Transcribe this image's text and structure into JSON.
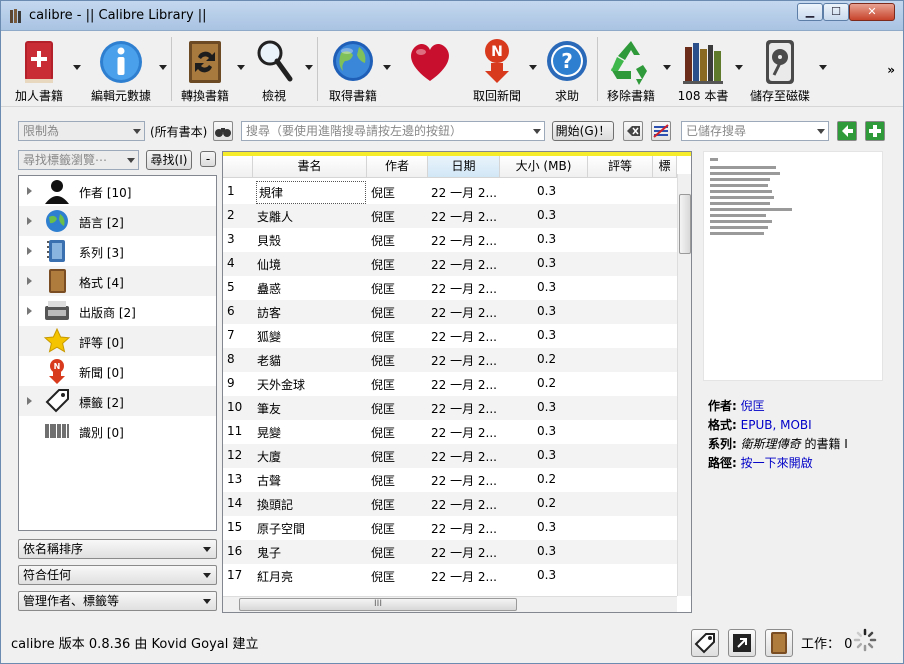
{
  "window": {
    "title": "calibre - || Calibre Library ||",
    "min": "▁",
    "max": "☐",
    "close": "✕"
  },
  "toolbar": {
    "buttons": [
      {
        "label": "加人書籍",
        "icon": "add-book-icon"
      },
      {
        "label": "編輯元數據",
        "icon": "info-icon"
      },
      {
        "label": "轉換書籍",
        "icon": "convert-book-icon"
      },
      {
        "label": "檢視",
        "icon": "magnifier-icon"
      },
      {
        "label": "取得書籍",
        "icon": "globe-icon"
      },
      {
        "label": "",
        "icon": "heart-icon"
      },
      {
        "label": "取回新聞",
        "icon": "news-icon"
      },
      {
        "label": "求助",
        "icon": "help-icon"
      },
      {
        "label": "移除書籍",
        "icon": "recycle-icon"
      },
      {
        "label": "108 本書",
        "icon": "library-icon"
      },
      {
        "label": "儲存至磁碟",
        "icon": "save-disk-icon"
      }
    ],
    "more": "»"
  },
  "search": {
    "restrict_placeholder": "限制為",
    "all_books": "(所有書本)",
    "search_placeholder": "搜尋（要使用進階搜尋請按左邊的按鈕）",
    "go_label": "開始(G)！",
    "saved_placeholder": "已儲存搜尋"
  },
  "tag_browser": {
    "find_placeholder": "尋找標籤瀏覽⋯",
    "find_button": "尋找(I)",
    "collapse_button": "-",
    "items": [
      {
        "label": "作者 [10]",
        "icon": "author-icon",
        "expandable": true
      },
      {
        "label": "語言 [2]",
        "icon": "language-icon",
        "expandable": true
      },
      {
        "label": "系列 [3]",
        "icon": "series-icon",
        "expandable": true
      },
      {
        "label": "格式 [4]",
        "icon": "format-icon",
        "expandable": true
      },
      {
        "label": "出版商 [2]",
        "icon": "publisher-icon",
        "expandable": true
      },
      {
        "label": "評等 [0]",
        "icon": "rating-star-icon",
        "expandable": false
      },
      {
        "label": "新聞 [0]",
        "icon": "news-icon",
        "expandable": false
      },
      {
        "label": "標籤 [2]",
        "icon": "tag-icon",
        "expandable": true
      },
      {
        "label": "識別 [0]",
        "icon": "barcode-icon",
        "expandable": false
      }
    ],
    "sort_by": "依名稱排序",
    "match": "符合任何",
    "manage": "管理作者、標籤等"
  },
  "book_list": {
    "columns": [
      "書名",
      "作者",
      "日期",
      "大小 (MB)",
      "評等",
      "標"
    ],
    "rows": [
      {
        "n": "1",
        "title": "規律",
        "author": "倪匡",
        "date": "22 一月 2...",
        "size": "0.3"
      },
      {
        "n": "2",
        "title": "支離人",
        "author": "倪匡",
        "date": "22 一月 2...",
        "size": "0.3"
      },
      {
        "n": "3",
        "title": "貝殼",
        "author": "倪匡",
        "date": "22 一月 2...",
        "size": "0.3"
      },
      {
        "n": "4",
        "title": "仙境",
        "author": "倪匡",
        "date": "22 一月 2...",
        "size": "0.3"
      },
      {
        "n": "5",
        "title": "蠱惑",
        "author": "倪匡",
        "date": "22 一月 2...",
        "size": "0.3"
      },
      {
        "n": "6",
        "title": "訪客",
        "author": "倪匡",
        "date": "22 一月 2...",
        "size": "0.3"
      },
      {
        "n": "7",
        "title": "狐變",
        "author": "倪匡",
        "date": "22 一月 2...",
        "size": "0.3"
      },
      {
        "n": "8",
        "title": "老貓",
        "author": "倪匡",
        "date": "22 一月 2...",
        "size": "0.2"
      },
      {
        "n": "9",
        "title": "天外金球",
        "author": "倪匡",
        "date": "22 一月 2...",
        "size": "0.2"
      },
      {
        "n": "10",
        "title": "筆友",
        "author": "倪匡",
        "date": "22 一月 2...",
        "size": "0.3"
      },
      {
        "n": "11",
        "title": "晃變",
        "author": "倪匡",
        "date": "22 一月 2...",
        "size": "0.3"
      },
      {
        "n": "12",
        "title": "大廈",
        "author": "倪匡",
        "date": "22 一月 2...",
        "size": "0.3"
      },
      {
        "n": "13",
        "title": "古聲",
        "author": "倪匡",
        "date": "22 一月 2...",
        "size": "0.2"
      },
      {
        "n": "14",
        "title": "換頭記",
        "author": "倪匡",
        "date": "22 一月 2...",
        "size": "0.2"
      },
      {
        "n": "15",
        "title": "原子空間",
        "author": "倪匡",
        "date": "22 一月 2...",
        "size": "0.3"
      },
      {
        "n": "16",
        "title": "鬼子",
        "author": "倪匡",
        "date": "22 一月 2...",
        "size": "0.3"
      },
      {
        "n": "17",
        "title": "紅月亮",
        "author": "倪匡",
        "date": "22 一月 2...",
        "size": "0.3"
      }
    ],
    "hscroll_grip": "III"
  },
  "details": {
    "author_label": "作者:",
    "author_value": "倪匡",
    "formats_label": "格式:",
    "formats_value": "EPUB, MOBI",
    "series_label": "系列:",
    "series_value": "衛斯理傳奇",
    "series_suffix": " 的書籍 I",
    "path_label": "路徑:",
    "path_value": "按一下來開啟"
  },
  "status": {
    "version_text": "calibre 版本 0.8.36 由 Kovid Goyal 建立",
    "jobs_text": "工作： 0"
  }
}
